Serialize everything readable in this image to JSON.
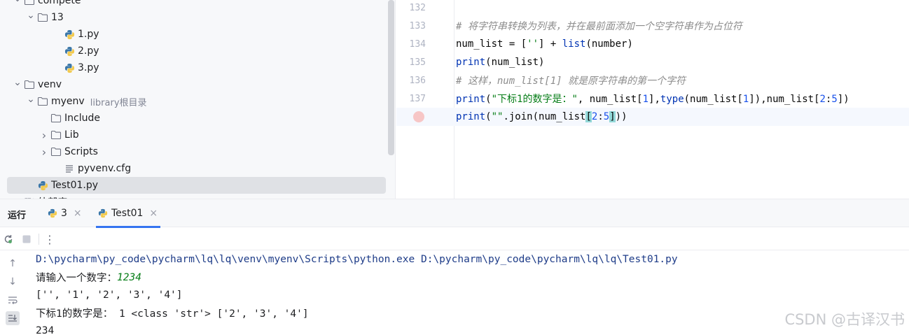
{
  "tree": {
    "items": [
      {
        "label": "compete",
        "kind": "folder",
        "chevron": "open",
        "level": 1
      },
      {
        "label": "13",
        "kind": "folder",
        "chevron": "open",
        "level": 2
      },
      {
        "label": "1.py",
        "kind": "python",
        "chevron": "",
        "level": 4
      },
      {
        "label": "2.py",
        "kind": "python",
        "chevron": "",
        "level": 4
      },
      {
        "label": "3.py",
        "kind": "python",
        "chevron": "",
        "level": 4
      },
      {
        "label": "venv",
        "kind": "folder",
        "chevron": "open",
        "level": 1
      },
      {
        "label": "myenv",
        "kind": "folder",
        "chevron": "open",
        "level": 2,
        "sublabel": "library根目录"
      },
      {
        "label": "Include",
        "kind": "folder",
        "chevron": "",
        "level": 3
      },
      {
        "label": "Lib",
        "kind": "folder",
        "chevron": "closed",
        "level": 3
      },
      {
        "label": "Scripts",
        "kind": "folder",
        "chevron": "closed",
        "level": 3
      },
      {
        "label": "pyvenv.cfg",
        "kind": "file",
        "chevron": "",
        "level": 4
      },
      {
        "label": "Test01.py",
        "kind": "python",
        "chevron": "",
        "level": 2,
        "selected": true
      },
      {
        "label": "外部库",
        "kind": "library",
        "chevron": "closed",
        "level": 1
      }
    ]
  },
  "editor": {
    "lines": [
      {
        "num": "132",
        "tokens": []
      },
      {
        "num": "133",
        "tokens": [
          {
            "t": "# 将字符串转换为列表，并在最前面添加一个空字符串作为占位符",
            "c": "cm"
          }
        ]
      },
      {
        "num": "134",
        "tokens": [
          {
            "t": "num_list = [",
            "c": ""
          },
          {
            "t": "''",
            "c": "str"
          },
          {
            "t": "] + ",
            "c": ""
          },
          {
            "t": "list",
            "c": "fn"
          },
          {
            "t": "(number)",
            "c": ""
          }
        ]
      },
      {
        "num": "135",
        "tokens": [
          {
            "t": "print",
            "c": "fn"
          },
          {
            "t": "(num_list)",
            "c": ""
          }
        ]
      },
      {
        "num": "136",
        "tokens": [
          {
            "t": "# 这样，num_list[1] 就是原字符串的第一个字符",
            "c": "cm"
          }
        ]
      },
      {
        "num": "137",
        "tokens": [
          {
            "t": "print",
            "c": "fn"
          },
          {
            "t": "(",
            "c": ""
          },
          {
            "t": "\"下标1的数字是：\"",
            "c": "str"
          },
          {
            "t": ", num_list[",
            "c": ""
          },
          {
            "t": "1",
            "c": "num"
          },
          {
            "t": "],",
            "c": ""
          },
          {
            "t": "type",
            "c": "fn"
          },
          {
            "t": "(num_list[",
            "c": ""
          },
          {
            "t": "1",
            "c": "num"
          },
          {
            "t": "]),num_list[",
            "c": ""
          },
          {
            "t": "2",
            "c": "num"
          },
          {
            "t": ":",
            "c": ""
          },
          {
            "t": "5",
            "c": "num"
          },
          {
            "t": "])",
            "c": ""
          }
        ]
      },
      {
        "num": "",
        "breakpoint": true,
        "current": true,
        "tokens": [
          {
            "t": "print",
            "c": "fn"
          },
          {
            "t": "(",
            "c": ""
          },
          {
            "t": "\"\"",
            "c": "str"
          },
          {
            "t": ".join(num_list",
            "c": ""
          },
          {
            "t": "[",
            "c": "brk"
          },
          {
            "t": "2",
            "c": "num"
          },
          {
            "t": ":",
            "c": ""
          },
          {
            "t": "5",
            "c": "num"
          },
          {
            "t": "]",
            "c": "brk"
          },
          {
            "t": "))",
            "c": ""
          }
        ]
      }
    ]
  },
  "run": {
    "title": "运行",
    "tabs": [
      {
        "label": "3",
        "active": false
      },
      {
        "label": "Test01",
        "active": true
      }
    ],
    "console": [
      {
        "text": "D:\\pycharm\\py_code\\pycharm\\lq\\lq\\venv\\myenv\\Scripts\\python.exe D:\\pycharm\\py_code\\pycharm\\lq\\lq\\Test01.py",
        "kind": "cmd"
      },
      {
        "text": "请输入一个数字：",
        "input": "1234",
        "kind": "prompt"
      },
      {
        "text": "['', '1', '2', '3', '4']",
        "kind": "out"
      },
      {
        "text": "下标1的数字是： 1 <class 'str'> ['2', '3', '4']",
        "kind": "out"
      },
      {
        "text": "234",
        "kind": "out"
      }
    ]
  },
  "watermark": "CSDN @古译汉书",
  "colors": {
    "accent": "#3574f0",
    "keyword": "#0033b3",
    "string": "#067d17",
    "number": "#1750eb",
    "comment": "#8c8c8c"
  }
}
